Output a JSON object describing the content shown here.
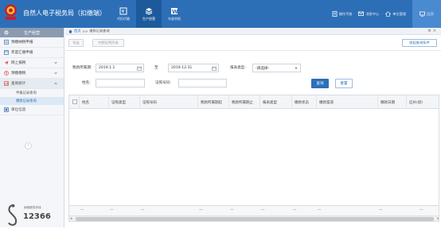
{
  "header": {
    "title": "自然人电子税务局（扣缴端）",
    "nav": [
      {
        "label": "代扣代缴",
        "icon": "tax-withholding-icon",
        "active": false
      },
      {
        "label": "生产经营",
        "icon": "stack-icon",
        "active": true
      },
      {
        "label": "年度申报",
        "icon": "word-doc-icon",
        "active": false
      }
    ],
    "tools": [
      {
        "label": "操作手册",
        "icon": "manual-icon"
      },
      {
        "label": "消息中心",
        "icon": "message-icon"
      },
      {
        "label": "单位管理",
        "icon": "home-icon"
      }
    ],
    "go_label": "回顶"
  },
  "sidebar": {
    "header": "生产经营",
    "items": [
      {
        "label": "预缴纳税申报",
        "icon": "declare-icon",
        "arrow": false
      },
      {
        "label": "年度汇缴申报",
        "icon": "annual-icon",
        "arrow": false
      },
      {
        "label": "网上报税",
        "icon": "send-icon",
        "arrow": true
      },
      {
        "label": "预缴缴税",
        "icon": "payment-icon",
        "arrow": true
      },
      {
        "label": "查询统计",
        "icon": "query-icon",
        "arrow": true
      }
    ],
    "subitems": [
      {
        "label": "申报记录查询",
        "active": false
      },
      {
        "label": "缴款记录查询",
        "active": true
      }
    ],
    "unit_info": "单位信息",
    "hotline_small": "纳税服务热线",
    "hotline": "12366"
  },
  "breadcrumb": {
    "home": "首页",
    "sep": ">>",
    "current": "缴款记录查询"
  },
  "toolbar": {
    "export": "导出",
    "print": "完税证明开具",
    "collapse": "收起查询条件"
  },
  "form": {
    "period_label": "税款所属期:",
    "period_start": "2019.1.1",
    "to_label": "至",
    "period_end": "2019.12.31",
    "report_type_label": "报表类型:",
    "report_type_value": "-请选择-",
    "name_label": "姓名:",
    "name_value": "",
    "id_label": "证照号码:",
    "id_value": "",
    "query_btn": "查询",
    "reset_btn": "重置"
  },
  "table": {
    "columns": [
      "姓名",
      "证照类型",
      "证照号码",
      "税款所属期起",
      "税款所属期止",
      "报表类型",
      "缴款状态",
      "缴款渠道",
      "缴款日期",
      "应补(退)"
    ],
    "footer": [
      "—",
      "—",
      "—",
      "—",
      "—",
      "—",
      "—",
      "—",
      "—",
      "—"
    ]
  }
}
